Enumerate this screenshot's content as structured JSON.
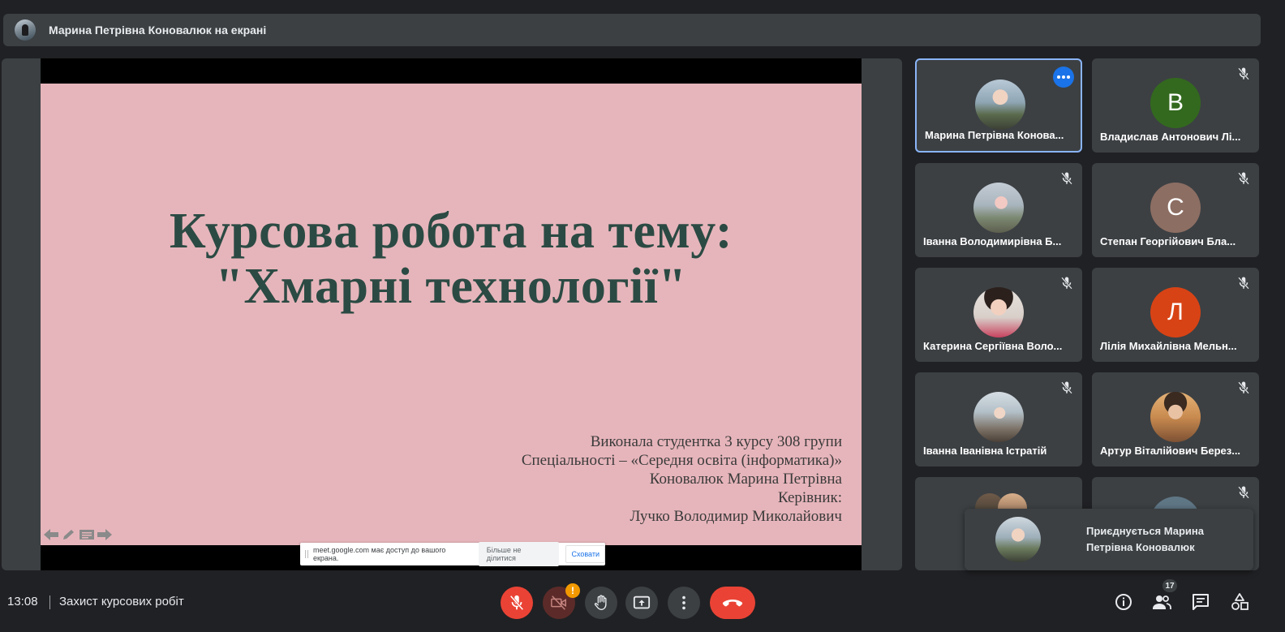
{
  "banner": {
    "presenter_text": "Марина Петрівна Коновалюк на екрані"
  },
  "slide": {
    "title_line1": "Курсова робота на тему:",
    "title_line2": "\"Хмарні технології\"",
    "info": [
      "Виконала студентка 3 курсу 308 групи",
      "Спеціальності – «Середня освіта (інформатика)»",
      "Коновалюк Марина Петрівна",
      "Керівник:",
      "Лучко Володимир Миколайович"
    ]
  },
  "share_bar": {
    "message": "meet.google.com має доступ до вашого екрана.",
    "stop_label": "Більше не ділитися",
    "hide_label": "Сховати"
  },
  "participants": [
    {
      "name": "Марина Петрівна Конова...",
      "avatar": "photo"
    },
    {
      "name": "Владислав Антонович Лі...",
      "initial": "В",
      "color": "#33691e"
    },
    {
      "name": "Іванна Володимирівна Б...",
      "avatar": "photo"
    },
    {
      "name": "Степан Георгійович Бла...",
      "initial": "С",
      "color": "#8d6e63"
    },
    {
      "name": "Катерина Сергіївна Воло...",
      "avatar": "photo"
    },
    {
      "name": "Лілія Михайлівна Мельн...",
      "initial": "Л",
      "color": "#d84315"
    },
    {
      "name": "Іванна Іванівна Істратій",
      "avatar": "photo"
    },
    {
      "name": "Артур Віталійович Берез...",
      "avatar": "photo"
    }
  ],
  "toast": {
    "text": "Приєднується Марина Петрівна Коновалюк"
  },
  "bottom": {
    "time": "13:08",
    "meeting_name": "Захист курсових робіт",
    "warning_badge": "!",
    "participant_count": "17"
  },
  "colors": {
    "accent": "#8ab4f8",
    "danger": "#ea4335",
    "panel": "#3c4043",
    "background": "#202124",
    "slide_bg": "#e6b5bb",
    "slide_title": "#2b4a43"
  }
}
